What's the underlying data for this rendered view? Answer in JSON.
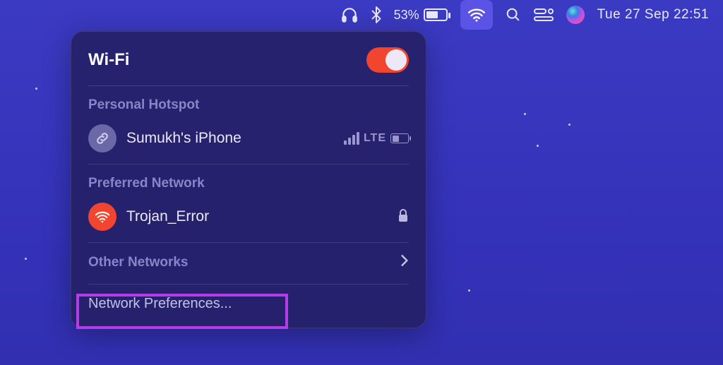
{
  "menubar": {
    "battery_percent": "53%",
    "datetime": "Tue 27 Sep  22:51"
  },
  "dropdown": {
    "title": "Wi-Fi",
    "toggle_on": true,
    "hotspot": {
      "section_label": "Personal Hotspot",
      "device_name": "Sumukh's iPhone",
      "network_type": "LTE"
    },
    "preferred": {
      "section_label": "Preferred Network",
      "network_name": "Trojan_Error",
      "locked": true
    },
    "other_label": "Other Networks",
    "preferences_label": "Network Preferences..."
  },
  "colors": {
    "accent_red": "#f2452f",
    "highlight": "#b53de8",
    "wifi_active_bg": "#5b52e6"
  }
}
